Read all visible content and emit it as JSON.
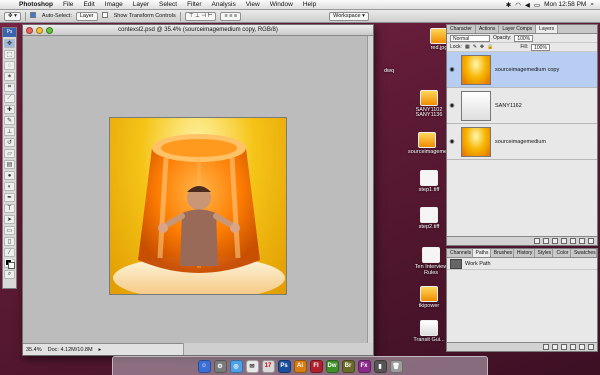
{
  "menubar": {
    "app": "Photoshop",
    "items": [
      "File",
      "Edit",
      "Image",
      "Layer",
      "Select",
      "Filter",
      "Analysis",
      "View",
      "Window",
      "Help"
    ],
    "clock": "Mon 12:58 PM"
  },
  "options": {
    "auto_select": "Auto-Select:",
    "auto_select_value": "Layer",
    "show_transform": "Show Transform Controls",
    "workspace": "Workspace ▾"
  },
  "tools": {
    "header": "Ps"
  },
  "document": {
    "title": "contexsl2.psd @ 35.4% (sourceimagemedium copy, RGB/8)",
    "zoom": "35.4%",
    "doc_size": "Doc: 4.12M/10.8M"
  },
  "desktop": {
    "icons": [
      {
        "label": "red.jpg"
      },
      {
        "label": "dwq"
      },
      {
        "label": "SANY1102"
      },
      {
        "label": "SANY1136"
      },
      {
        "label": "sourceimagemedium"
      },
      {
        "label": "step1.tiff"
      },
      {
        "label": "step2.tiff"
      },
      {
        "label": "Ten Interview Rules"
      },
      {
        "label": "tkipower"
      },
      {
        "label": "Transit Gui..."
      }
    ]
  },
  "layers": {
    "tabs": [
      "Character",
      "Actions",
      "Layer Comps",
      "Layers"
    ],
    "blend_mode": "Normal",
    "opacity_label": "Opacity:",
    "opacity": "100%",
    "lock_label": "Lock:",
    "fill_label": "Fill:",
    "fill": "100%",
    "items": [
      {
        "name": "sourceimagemedium copy",
        "selected": true
      },
      {
        "name": "SANY1162",
        "selected": false
      },
      {
        "name": "sourceimagemedium",
        "selected": false
      }
    ]
  },
  "paths": {
    "tabs": [
      "Channels",
      "Paths",
      "Brushes",
      "History",
      "Styles",
      "Color",
      "Swatches"
    ],
    "items": [
      {
        "name": "Work Path"
      }
    ]
  },
  "dock": {
    "items": [
      "Ps",
      "Ai",
      "Fl",
      "Dw",
      "Br",
      "Fx"
    ]
  }
}
